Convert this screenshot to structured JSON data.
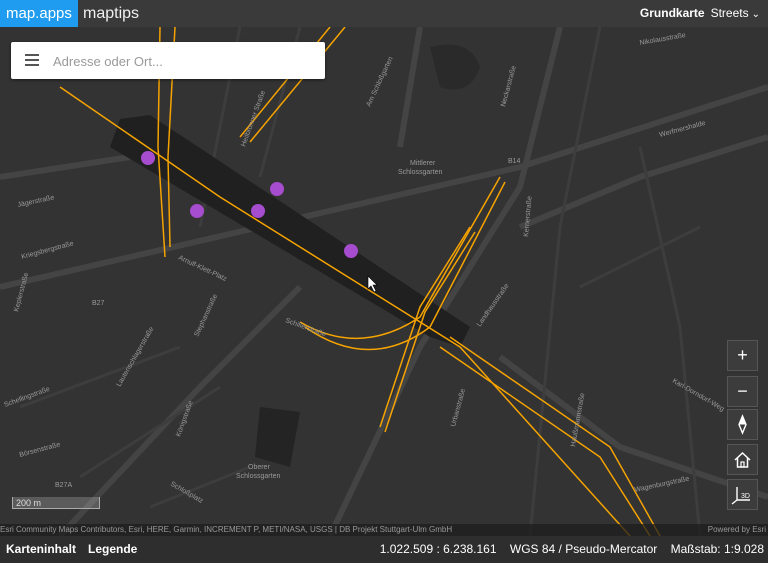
{
  "header": {
    "brand": "map.apps",
    "title": "maptips",
    "basemap_label": "Grundkarte",
    "basemap_value": "Streets"
  },
  "search": {
    "placeholder": "Adresse oder Ort..."
  },
  "controls": {
    "zoom_in": "+",
    "zoom_out": "−"
  },
  "scalebar": "200 m",
  "attribution": {
    "left": "Esri Community Maps Contributors, Esri, HERE, Garmin, INCREMENT P, METI/NASA, USGS | DB Projekt Stuttgart-Ulm GmbH",
    "right": "Powered by Esri"
  },
  "footer": {
    "tab1": "Karteninhalt",
    "tab2": "Legende",
    "coordinates": "1.022.509 : 6.238.161",
    "crs": "WGS 84 / Pseudo-Mercator",
    "scale": "Maßstab: 1:9.028"
  },
  "map_labels": {
    "mittlerer": "Mittlerer",
    "schlossgarten": "Schlossgarten",
    "oberer": "Oberer",
    "schlossgarten2": "Schlossgarten",
    "kriegsberg": "Kriegsbergstraße",
    "jaegerstr": "Jägerstraße",
    "schillerstr": "Schillerstraße",
    "arnulf": "Arnulf-Klett-Platz",
    "kepler": "Keplerstraße",
    "lautenschlager": "Lautenschlagerstraße",
    "koenigstr": "Königstraße",
    "schlossplatz": "Schloßplatz",
    "stephan": "Stephanstraße",
    "boersen": "Börsenstraße",
    "schelling": "Schellingstraße",
    "urban": "Urbanstraße",
    "kerner": "Kernerstraße",
    "landhaus": "Landhausstraße",
    "neckar": "Neckarstraße",
    "nikolaus": "Nikolausstraße",
    "hausmann": "Haußmannstraße",
    "werfmershalde": "Werfmershalde",
    "wagenburg": "Wagenburgstraße",
    "b14": "B14",
    "b27": "B27",
    "b27a": "B27A",
    "am_schlossgarten": "Am Schloßgarten",
    "karl": "Karl-Dorndorf-Weg",
    "heilbronner": "Heilbronner Straße"
  },
  "colors": {
    "brand": "#1f9cf0",
    "rail": "#f5a300",
    "marker": "#a64ccf"
  }
}
